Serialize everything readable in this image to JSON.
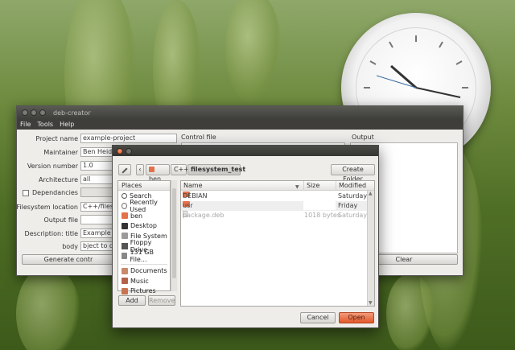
{
  "window": {
    "title": "deb-creator",
    "menu": [
      "File",
      "Tools",
      "Help"
    ]
  },
  "form": {
    "project_name_label": "Project name",
    "project_name_value": "example-project",
    "maintainer_label": "Maintainer",
    "maintainer_value": "Ben Heiden",
    "version_label": "Version number",
    "version_value": "1.0",
    "architecture_label": "Architecture",
    "architecture_value": "all",
    "dependancies_label": "Dependancies",
    "filesystem_label": "Filesystem location",
    "filesystem_value": "C++/filesyst",
    "output_file_label": "Output file",
    "output_file_value": "",
    "desc_title_label": "Description: title",
    "desc_title_value": "Example pr",
    "body_label": "body",
    "body_value": "bject to dem",
    "generate_button": "Generate contr",
    "control_file_label": "Control file",
    "output_label": "Output",
    "clear_button": "Clear"
  },
  "dialog": {
    "path": [
      "ben",
      "C++",
      "filesystem_test"
    ],
    "create_folder_button": "Create Folder",
    "places_header": "Places",
    "places": [
      {
        "label": "Search",
        "icon": "search-icon"
      },
      {
        "label": "Recently Used",
        "icon": "clock-icon"
      },
      {
        "label": "ben",
        "icon": "home-folder-icon"
      },
      {
        "label": "Desktop",
        "icon": "desktop-icon"
      },
      {
        "label": "File System",
        "icon": "drive-icon"
      },
      {
        "label": "Floppy Drive",
        "icon": "floppy-icon"
      },
      {
        "label": "131 GB File...",
        "icon": "drive-icon"
      },
      {
        "label": "Documents",
        "icon": "folder-icon"
      },
      {
        "label": "Music",
        "icon": "music-folder-icon"
      },
      {
        "label": "Pictures",
        "icon": "pictures-folder-icon"
      }
    ],
    "columns": {
      "name": "Name",
      "size": "Size",
      "modified": "Modified"
    },
    "files": [
      {
        "name": "DEBIAN",
        "size": "",
        "modified": "Saturday",
        "type": "folder"
      },
      {
        "name": "usr",
        "size": "",
        "modified": "Friday",
        "type": "folder"
      },
      {
        "name": "package.deb",
        "size": "1018 bytes",
        "modified": "Saturday",
        "type": "file"
      }
    ],
    "add_button": "Add",
    "remove_button": "Remove",
    "cancel_button": "Cancel",
    "open_button": "Open"
  },
  "colors": {
    "accent": "#e2582b",
    "titlebar": "#3e3e3b",
    "window_bg": "#efedea"
  }
}
